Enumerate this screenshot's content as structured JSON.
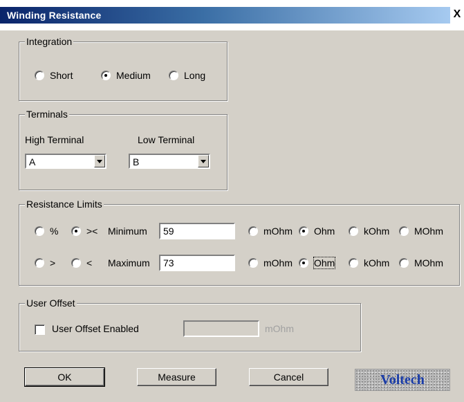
{
  "window": {
    "title": "Winding Resistance",
    "close_glyph": "X"
  },
  "integration": {
    "legend": "Integration",
    "options": [
      {
        "label": "Short",
        "selected": false
      },
      {
        "label": "Medium",
        "selected": true
      },
      {
        "label": "Long",
        "selected": false
      }
    ]
  },
  "terminals": {
    "legend": "Terminals",
    "high_label": "High Terminal",
    "high_value": "A",
    "low_label": "Low Terminal",
    "low_value": "B"
  },
  "limits": {
    "legend": "Resistance Limits",
    "mode_options": [
      {
        "label": "%",
        "selected": false
      },
      {
        "label": "><",
        "selected": true
      },
      {
        "label": ">",
        "selected": false
      },
      {
        "label": "<",
        "selected": false
      }
    ],
    "minimum": {
      "label": "Minimum",
      "value": "59",
      "units": [
        {
          "label": "mOhm",
          "selected": false
        },
        {
          "label": "Ohm",
          "selected": true
        },
        {
          "label": "kOhm",
          "selected": false
        },
        {
          "label": "MOhm",
          "selected": false
        }
      ]
    },
    "maximum": {
      "label": "Maximum",
      "value": "73",
      "units": [
        {
          "label": "mOhm",
          "selected": false
        },
        {
          "label": "Ohm",
          "selected": true
        },
        {
          "label": "kOhm",
          "selected": false
        },
        {
          "label": "MOhm",
          "selected": false
        }
      ]
    }
  },
  "user_offset": {
    "legend": "User Offset",
    "checkbox_label": "User Offset Enabled",
    "checked": false,
    "value": "",
    "unit": "mOhm"
  },
  "buttons": {
    "ok": "OK",
    "measure": "Measure",
    "cancel": "Cancel"
  },
  "logo": {
    "text": "Voltech"
  }
}
